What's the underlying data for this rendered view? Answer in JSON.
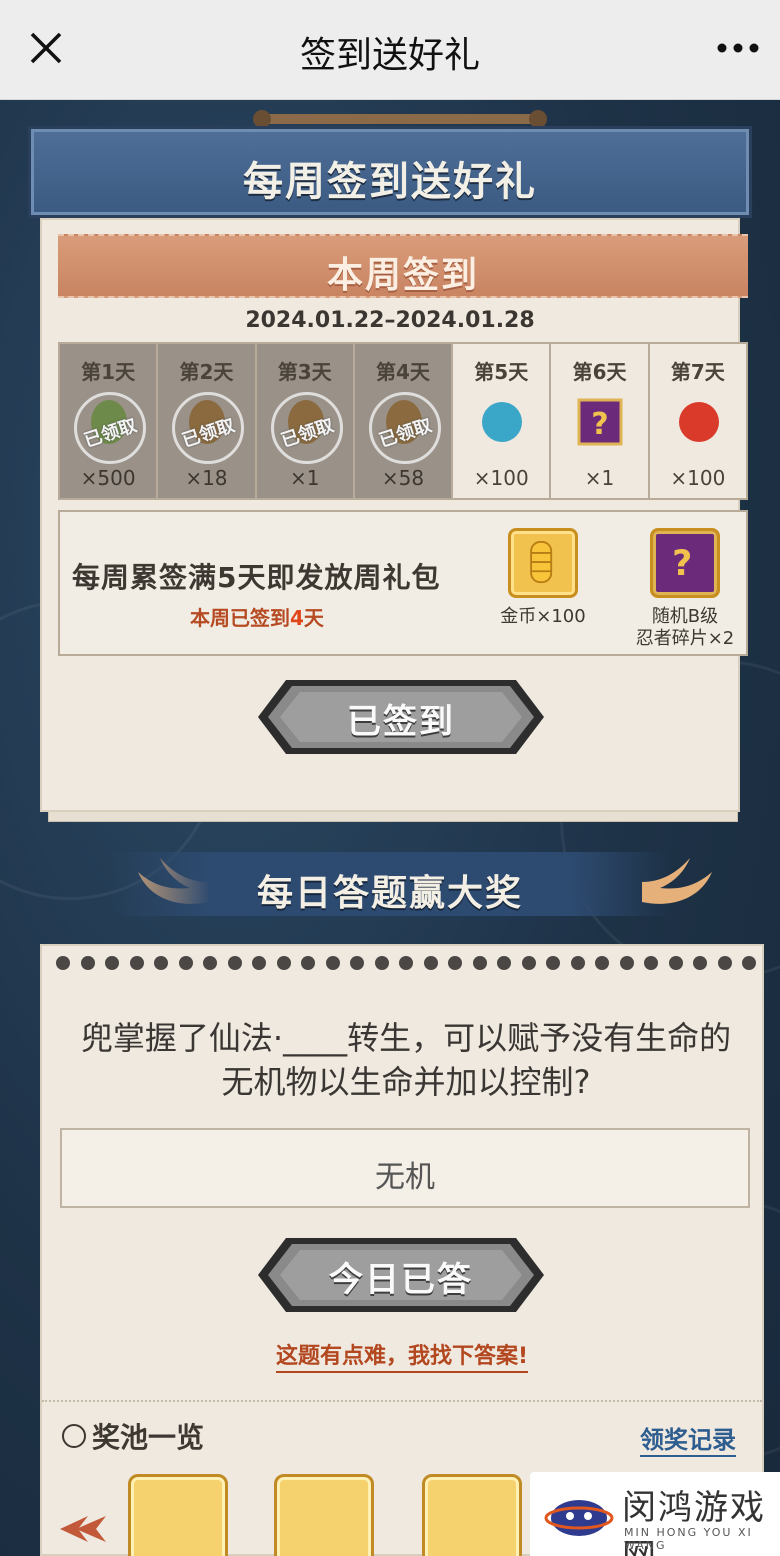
{
  "topbar": {
    "title": "签到送好礼",
    "close_icon": "close-icon",
    "more_icon": "more-icon"
  },
  "weekly": {
    "banner": "每周签到送好礼",
    "ribbon": "本周签到",
    "date_range": "2024.01.22–2024.01.28",
    "claimed_stamp": "已领取",
    "days": [
      {
        "label": "第1天",
        "qty": "×500",
        "claimed": true,
        "icon": "green-scroll-icon",
        "color": "#6e8a4a"
      },
      {
        "label": "第2天",
        "qty": "×18",
        "claimed": true,
        "icon": "scroll-icon",
        "color": "#8a6a3e"
      },
      {
        "label": "第3天",
        "qty": "×1",
        "claimed": true,
        "icon": "scroll-icon",
        "color": "#8a6a3e"
      },
      {
        "label": "第4天",
        "qty": "×58",
        "claimed": true,
        "icon": "scroll-icon",
        "color": "#8a6a3e"
      },
      {
        "label": "第5天",
        "qty": "×100",
        "claimed": false,
        "icon": "blue-orb-icon",
        "color": "#3aa6c8"
      },
      {
        "label": "第6天",
        "qty": "×1",
        "claimed": false,
        "icon": "mystery-box-icon",
        "color": "#6b2a7a"
      },
      {
        "label": "第7天",
        "qty": "×100",
        "claimed": false,
        "icon": "red-gem-icon",
        "color": "#d93a2a"
      }
    ],
    "bonus": {
      "text": "每周累签满5天即发放周礼包",
      "progress_prefix": "本周已签到",
      "progress_num": "4",
      "progress_suffix": "天",
      "rewards": [
        {
          "caption": "金币×100",
          "icon": "gold-coin-icon"
        },
        {
          "caption_line1": "随机B级",
          "caption_line2": "忍者碎片×2",
          "icon": "mystery-box-icon"
        }
      ]
    },
    "button": "已签到"
  },
  "quiz": {
    "banner": "每日答题赢大奖",
    "question": "兜掌握了仙法·____转生，可以赋予没有生命的无机物以生命并加以控制?",
    "answer": "无机",
    "button": "今日已答",
    "hint": "这题有点难，我找下答案!",
    "pool_title": "奖池一览",
    "records_link": "领奖记录"
  },
  "watermark": {
    "big": "闵鸿游戏网",
    "small": "MIN HONG YOU XI WANG"
  }
}
